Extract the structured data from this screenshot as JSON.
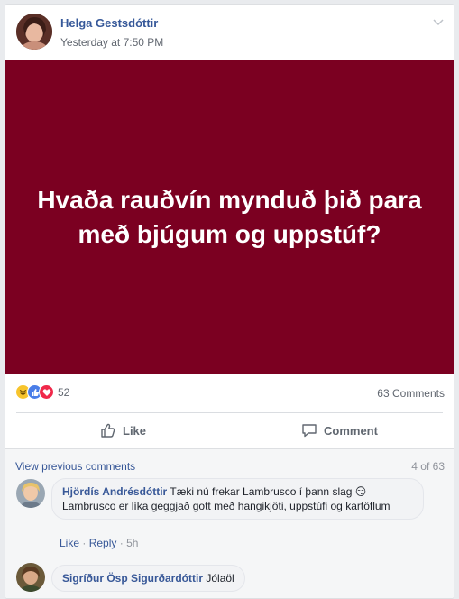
{
  "post": {
    "author": "Helga Gestsdóttir",
    "timestamp": "Yesterday at 7:50 PM",
    "banner_text": "Hvaða rauðvín mynduð þið para með bjúgum og uppstúf?",
    "banner_color": "#7b0021"
  },
  "stats": {
    "reaction_icons": [
      "haha-icon",
      "like-icon",
      "love-icon"
    ],
    "reaction_count": "52",
    "comment_count": "63 Comments"
  },
  "actions": {
    "like_label": "Like",
    "comment_label": "Comment"
  },
  "comments": {
    "view_previous": "View previous comments",
    "pager": "4 of 63",
    "items": [
      {
        "author": "Hjördís Andrésdóttir",
        "text": "Tæki nú frekar Lambrusco í þann slag 😏 Lambrusco er líka geggjað gott með hangikjöti, uppstúfi og kartöflum",
        "like": "Like",
        "reply": "Reply",
        "time": "5h"
      },
      {
        "author": "Sigríður Ösp Sigurðardóttir",
        "text": "Jólaöl"
      }
    ]
  }
}
